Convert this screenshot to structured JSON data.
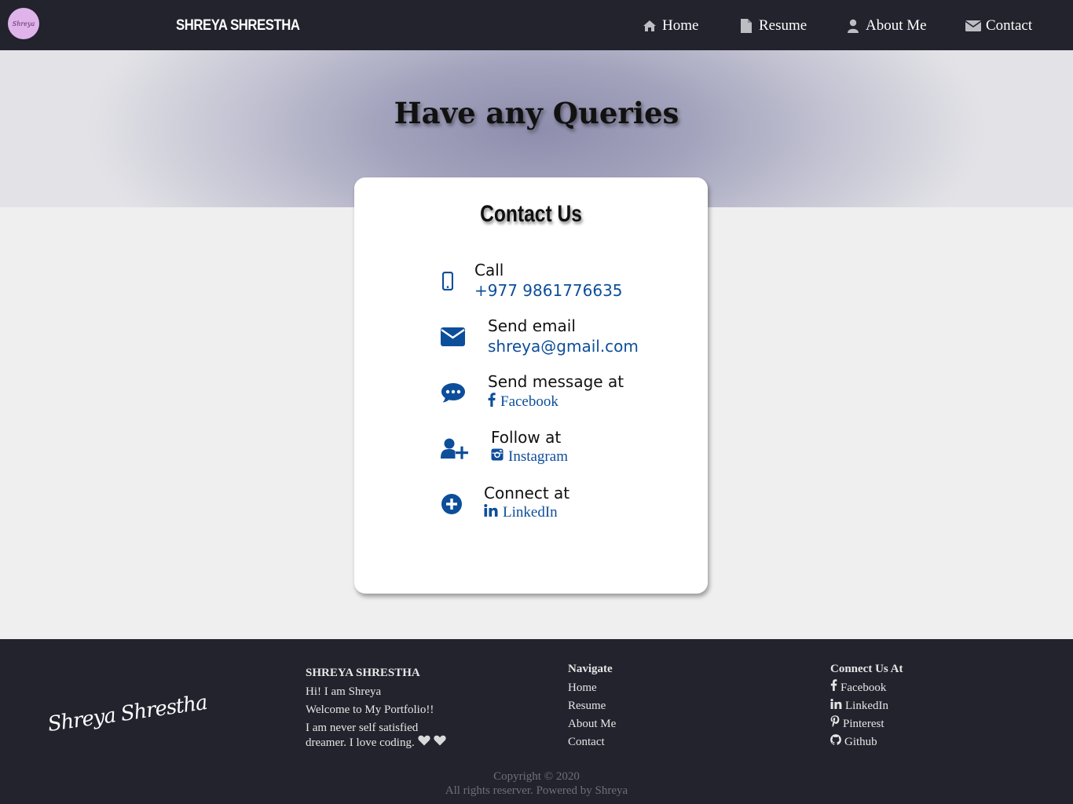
{
  "navbar": {
    "logo_text": "Shreya",
    "brand": "SHREYA SHRESTHA",
    "items": [
      {
        "label": "Home",
        "icon": "home-icon"
      },
      {
        "label": "Resume",
        "icon": "file-icon"
      },
      {
        "label": "About Me",
        "icon": "user-icon"
      },
      {
        "label": "Contact",
        "icon": "envelope-icon"
      }
    ]
  },
  "hero": {
    "title": "Have any Queries"
  },
  "contact_card": {
    "title": "Contact Us",
    "items": [
      {
        "label": "Call",
        "value": "+977 9861776635",
        "icon": "mobile-icon"
      },
      {
        "label": "Send email",
        "value": "shreya@gmail.com",
        "icon": "envelope-icon"
      },
      {
        "label": "Send message at",
        "value": "Facebook",
        "icon": "comment-dots-icon",
        "link_icon": "facebook-icon"
      },
      {
        "label": "Follow at",
        "value": "Instagram",
        "icon": "user-plus-icon",
        "link_icon": "instagram-icon"
      },
      {
        "label": "Connect at",
        "value": "LinkedIn",
        "icon": "plus-circle-icon",
        "link_icon": "linkedin-icon"
      }
    ]
  },
  "footer": {
    "signature": "Shreya Shrestha",
    "about": {
      "heading": "SHREYA SHRESTHA",
      "line1": "Hi! I am Shreya",
      "line2": "Welcome to My Portfolio!!",
      "line3a": "I am never self satisfied",
      "line3b": "dreamer. I love coding."
    },
    "navigate": {
      "heading": "Navigate",
      "links": [
        "Home",
        "Resume",
        "About Me",
        "Contact"
      ]
    },
    "connect": {
      "heading": "Connect Us At",
      "links": [
        {
          "label": "Facebook",
          "icon": "facebook-icon"
        },
        {
          "label": "LinkedIn",
          "icon": "linkedin-icon"
        },
        {
          "label": "Pinterest",
          "icon": "pinterest-icon"
        },
        {
          "label": "Github",
          "icon": "github-icon"
        }
      ]
    },
    "copyright_line1": "Copyright © 2020",
    "copyright_line2": "All rights reserver. Powered by Shreya"
  },
  "colors": {
    "nav_bg": "#22232d",
    "accent_blue": "#0d4e9a",
    "logo_pink": "#e0b3ea"
  }
}
